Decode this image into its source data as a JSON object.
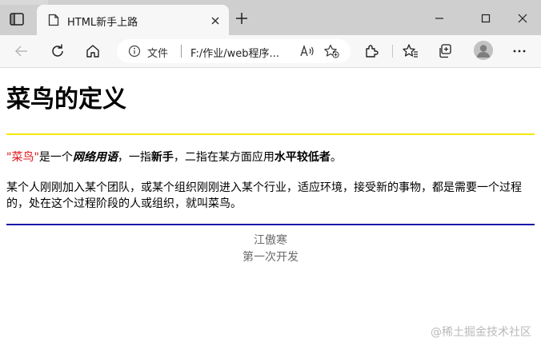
{
  "tab": {
    "title": "HTML新手上路"
  },
  "address_bar": {
    "scheme_label": "文件",
    "url": "F:/作业/web程序..."
  },
  "page": {
    "heading": "菜鸟的定义",
    "paragraph1": {
      "quoted_term": "\"菜鸟\"",
      "text_a": "是一个",
      "term_bold_italic": "网络用语",
      "text_b": "，一指",
      "term_newbie": "新手",
      "text_c": "，二指在某方面应用",
      "term_low_level": "水平较低者",
      "text_d": "。"
    },
    "paragraph2": "某个人刚刚加入某个团队，或某个组织刚刚进入某个行业，适应环境，接受新的事物，都是需要一个过程的，处在这个过程阶段的人或组织，就叫菜鸟。",
    "author": "江傲寒",
    "footer_note": "第一次开发"
  },
  "watermark": "@稀土掘金技术社区",
  "colors": {
    "title_bar": "#cfcfcf",
    "toolbar": "#f7f7f7",
    "yellow_rule": "#f5e800",
    "blue_rule": "#1a15a8",
    "red_text": "#e0161d",
    "muted_text": "#6b6b6b"
  },
  "icons": [
    "tab-actions-icon",
    "page-favicon-icon",
    "close-icon",
    "plus-icon",
    "minimize-icon",
    "maximize-icon",
    "window-close-icon",
    "back-icon",
    "refresh-icon",
    "home-icon",
    "info-icon",
    "read-aloud-icon",
    "add-favorite-icon",
    "extensions-icon",
    "favorites-icon",
    "collections-icon",
    "profile-icon",
    "more-icon"
  ]
}
